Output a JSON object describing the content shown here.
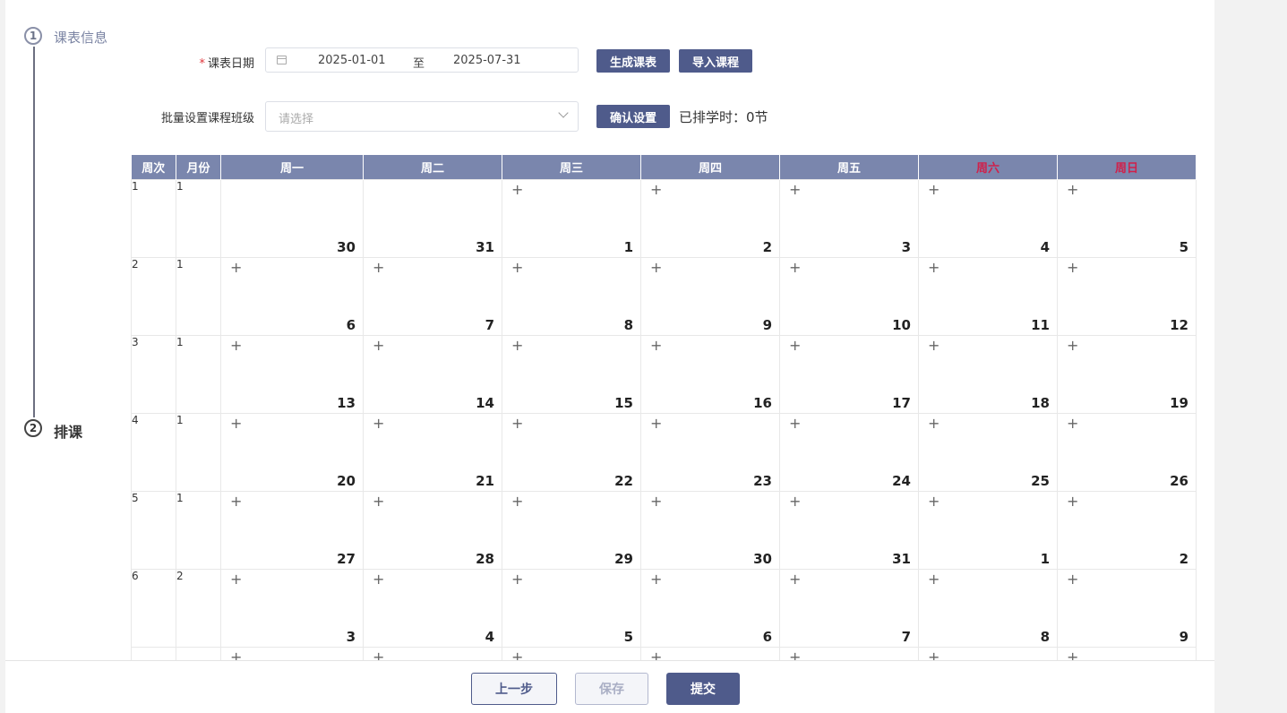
{
  "steps": [
    {
      "num": "1",
      "label": "课表信息"
    },
    {
      "num": "2",
      "label": "排课"
    }
  ],
  "form": {
    "date_label": "课表日期",
    "start_date": "2025-01-01",
    "range_separator": "至",
    "end_date": "2025-07-31",
    "generate_button": "生成课表",
    "import_button": "导入课程",
    "class_label": "批量设置课程班级",
    "class_placeholder": "请选择",
    "confirm_button": "确认设置",
    "scheduled_text": "已排学时：0节"
  },
  "calendar": {
    "headers": [
      "周次",
      "月份",
      "周一",
      "周二",
      "周三",
      "周四",
      "周五",
      "周六",
      "周日"
    ],
    "weekend_color": "#d0204a",
    "header_bg": "#7a86ad",
    "rows": [
      {
        "week": "1",
        "month": "1",
        "days": [
          "30",
          "31",
          "1",
          "2",
          "3",
          "4",
          "5"
        ],
        "add": [
          false,
          false,
          true,
          true,
          true,
          true,
          true
        ]
      },
      {
        "week": "2",
        "month": "1",
        "days": [
          "6",
          "7",
          "8",
          "9",
          "10",
          "11",
          "12"
        ],
        "add": [
          true,
          true,
          true,
          true,
          true,
          true,
          true
        ]
      },
      {
        "week": "3",
        "month": "1",
        "days": [
          "13",
          "14",
          "15",
          "16",
          "17",
          "18",
          "19"
        ],
        "add": [
          true,
          true,
          true,
          true,
          true,
          true,
          true
        ]
      },
      {
        "week": "4",
        "month": "1",
        "days": [
          "20",
          "21",
          "22",
          "23",
          "24",
          "25",
          "26"
        ],
        "add": [
          true,
          true,
          true,
          true,
          true,
          true,
          true
        ]
      },
      {
        "week": "5",
        "month": "1",
        "days": [
          "27",
          "28",
          "29",
          "30",
          "31",
          "1",
          "2"
        ],
        "add": [
          true,
          true,
          true,
          true,
          true,
          true,
          true
        ]
      },
      {
        "week": "6",
        "month": "2",
        "days": [
          "3",
          "4",
          "5",
          "6",
          "7",
          "8",
          "9"
        ],
        "add": [
          true,
          true,
          true,
          true,
          true,
          true,
          true
        ]
      },
      {
        "week": "",
        "month": "",
        "days": [
          "",
          "",
          "",
          "",
          "",
          "",
          ""
        ],
        "add": [
          true,
          true,
          true,
          true,
          true,
          true,
          true
        ]
      }
    ]
  },
  "footer": {
    "prev_button": "上一步",
    "save_button": "保存",
    "submit_button": "提交"
  },
  "colors": {
    "accent": "#4f5b8b",
    "required": "#e0353b"
  }
}
